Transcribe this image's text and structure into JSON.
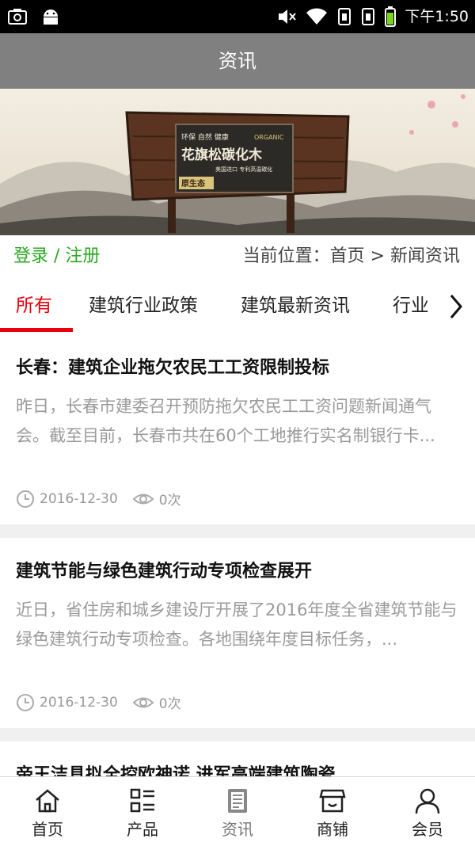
{
  "status_bar": {
    "time": "下午1:50",
    "icons": [
      "screenshot-icon",
      "android-icon",
      "mute-icon",
      "wifi-icon",
      "sim1-icon",
      "sim2-icon",
      "battery-icon"
    ]
  },
  "header": {
    "title": "资讯"
  },
  "banner": {
    "sign_tags": "环保 自然 健康",
    "sign_badge": "ORGANIC",
    "sign_brand": "花旗松碳化木",
    "sign_slogan": "美国进口 专利高温碳化",
    "sign_plaque": "原生态"
  },
  "location_bar": {
    "login_label": "登录 / 注册",
    "breadcrumb": "当前位置：首页 > 新闻资讯"
  },
  "tabs": {
    "items": [
      "所有",
      "建筑行业政策",
      "建筑最新资讯",
      "行业"
    ],
    "active_index": 0,
    "accent": "#e8000b"
  },
  "articles": [
    {
      "title": "长春：建筑企业拖欠农民工工资限制投标",
      "excerpt": "昨日，长春市建委召开预防拖欠农民工工资问题新闻通气会。截至目前，长春市共在60个工地推行实名制银行卡...",
      "date": "2016-12-30",
      "views": "0次"
    },
    {
      "title": "建筑节能与绿色建筑行动专项检查展开",
      "excerpt": "近日，省住房和城乡建设厅开展了2016年度全省建筑节能与绿色建筑行动专项检查。各地围绕年度目标任务，...",
      "date": "2016-12-30",
      "views": "0次"
    },
    {
      "title": "帝王洁具拟全控欧神诺 进军高端建筑陶瓷"
    }
  ],
  "bottom_nav": {
    "items": [
      "首页",
      "产品",
      "资讯",
      "商铺",
      "会员"
    ],
    "active_index": 2
  }
}
